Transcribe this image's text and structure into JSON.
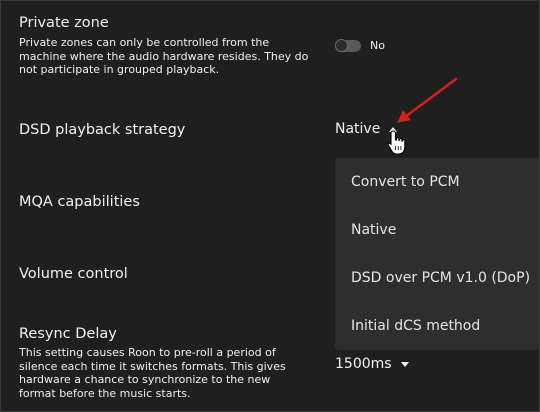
{
  "private_zone": {
    "title": "Private zone",
    "description": "Private zones can only be controlled from the machine where the audio hardware resides. They do not participate in grouped playback.",
    "toggle_state": "No"
  },
  "dsd_playback": {
    "title": "DSD playback strategy",
    "value": "Native",
    "options": [
      "Convert to PCM",
      "Native",
      "DSD over PCM v1.0 (DoP)",
      "Initial dCS method"
    ]
  },
  "mqa": {
    "title": "MQA capabilities"
  },
  "volume": {
    "title": "Volume control"
  },
  "resync": {
    "title": "Resync Delay",
    "description": "This setting causes Roon to pre-roll a period of silence each time it switches formats. This gives hardware a chance to synchronize to the new format before the music starts.",
    "value": "1500ms"
  },
  "colors": {
    "background": "#1f1f1f",
    "dropdown": "#2e2e2e",
    "annotation_arrow": "#d42020"
  },
  "icons": [
    "caret-up-icon",
    "caret-down-icon",
    "hand-cursor-icon",
    "red-arrow-annotation"
  ]
}
